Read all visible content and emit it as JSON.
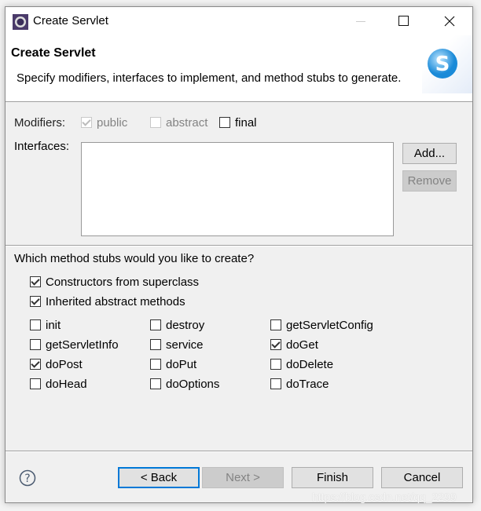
{
  "window": {
    "title": "Create Servlet"
  },
  "header": {
    "title": "Create Servlet",
    "description": "Specify modifiers, interfaces to implement, and method stubs to generate."
  },
  "modifiers": {
    "label": "Modifiers:",
    "items": [
      {
        "label": "public",
        "checked": true,
        "enabled": false
      },
      {
        "label": "abstract",
        "checked": false,
        "enabled": false
      },
      {
        "label": "final",
        "checked": false,
        "enabled": true
      }
    ]
  },
  "interfaces": {
    "label": "Interfaces:",
    "add": "Add...",
    "remove": "Remove"
  },
  "stubs": {
    "question": "Which method stubs would you like to create?",
    "general": [
      {
        "label": "Constructors from superclass",
        "checked": true
      },
      {
        "label": "Inherited abstract methods",
        "checked": true
      }
    ],
    "methods": [
      {
        "label": "init",
        "checked": false
      },
      {
        "label": "destroy",
        "checked": false
      },
      {
        "label": "getServletConfig",
        "checked": false
      },
      {
        "label": "getServletInfo",
        "checked": false
      },
      {
        "label": "service",
        "checked": false
      },
      {
        "label": "doGet",
        "checked": true
      },
      {
        "label": "doPost",
        "checked": true
      },
      {
        "label": "doPut",
        "checked": false
      },
      {
        "label": "doDelete",
        "checked": false
      },
      {
        "label": "doHead",
        "checked": false
      },
      {
        "label": "doOptions",
        "checked": false
      },
      {
        "label": "doTrace",
        "checked": false
      }
    ]
  },
  "footer": {
    "back": "< Back",
    "next": "Next >",
    "finish": "Finish",
    "cancel": "Cancel"
  },
  "watermark": "https://blog.csdn.net/qq_2299",
  "colors": {
    "focus": "#0078d7",
    "body": "#f0f0f0"
  }
}
